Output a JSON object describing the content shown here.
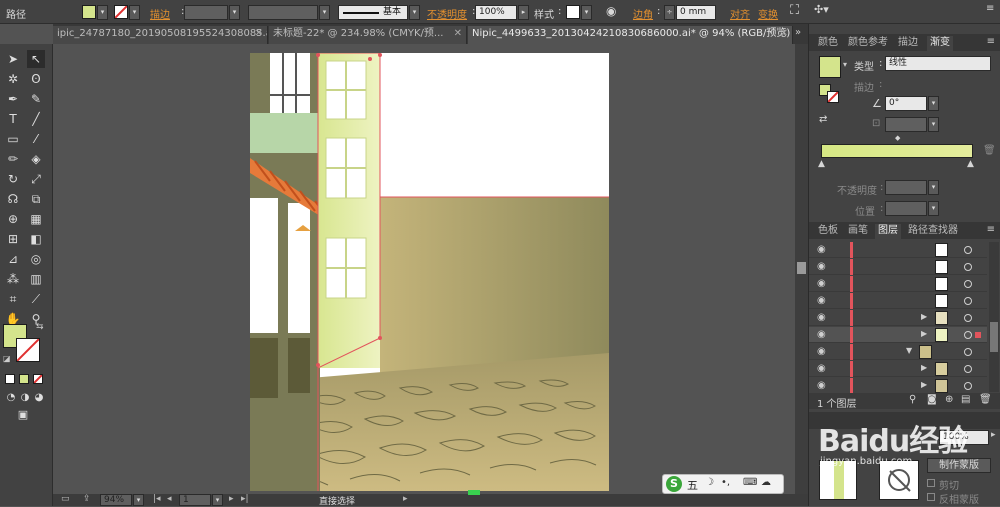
{
  "control_bar": {
    "object_type": "路径",
    "stroke_label": "描边",
    "stroke_profile": "基本",
    "opacity_label": "不透明度",
    "opacity_value": "100%",
    "style_label": "样式",
    "corner_label": "边角",
    "corner_value": "0 mm",
    "align_label": "对齐",
    "transform_label": "变换",
    "fill_color": "#d4e48c"
  },
  "document_tabs": [
    {
      "label": "ipic_24787180_20190508195524308085.ai*"
    },
    {
      "label": "未标题-22* @ 234.98% (CMYK/预..."
    },
    {
      "label": "Nipic_4499633_20130424210830686000.ai* @ 94% (RGB/预览)"
    }
  ],
  "gradient_panel": {
    "tabs": [
      "颜色",
      "颜色参考",
      "描边",
      "渐变"
    ],
    "type_label": "类型",
    "type_value": "线性",
    "stroke_label": "描边",
    "angle_value": "0°",
    "opacity_label": "不透明度",
    "position_label": "位置",
    "gradient_start": "#d6e884",
    "gradient_end": "#e4ec9c"
  },
  "layers_panel": {
    "tabs": [
      "色板",
      "画笔",
      "图层",
      "路径查找器"
    ],
    "footer_text": "1 个图层",
    "rows": 9
  },
  "transparency_panel": {
    "opacity_value": "100%",
    "make_mask_button": "制作蒙版",
    "clip_label": "剪切",
    "invert_label": "反相蒙版"
  },
  "status_bar": {
    "zoom": "94%",
    "page": "1",
    "tool_name": "直接选择"
  },
  "ime_toolbar": {
    "logo": "S",
    "mode": "五"
  },
  "watermark": {
    "text": "Baidu经验",
    "url": "jingyan.baidu.com"
  },
  "colors": {
    "app_bg": "#535353",
    "panel_bg": "#434343",
    "accent_orange": "#e3902f",
    "selection_red": "#e2545c"
  }
}
